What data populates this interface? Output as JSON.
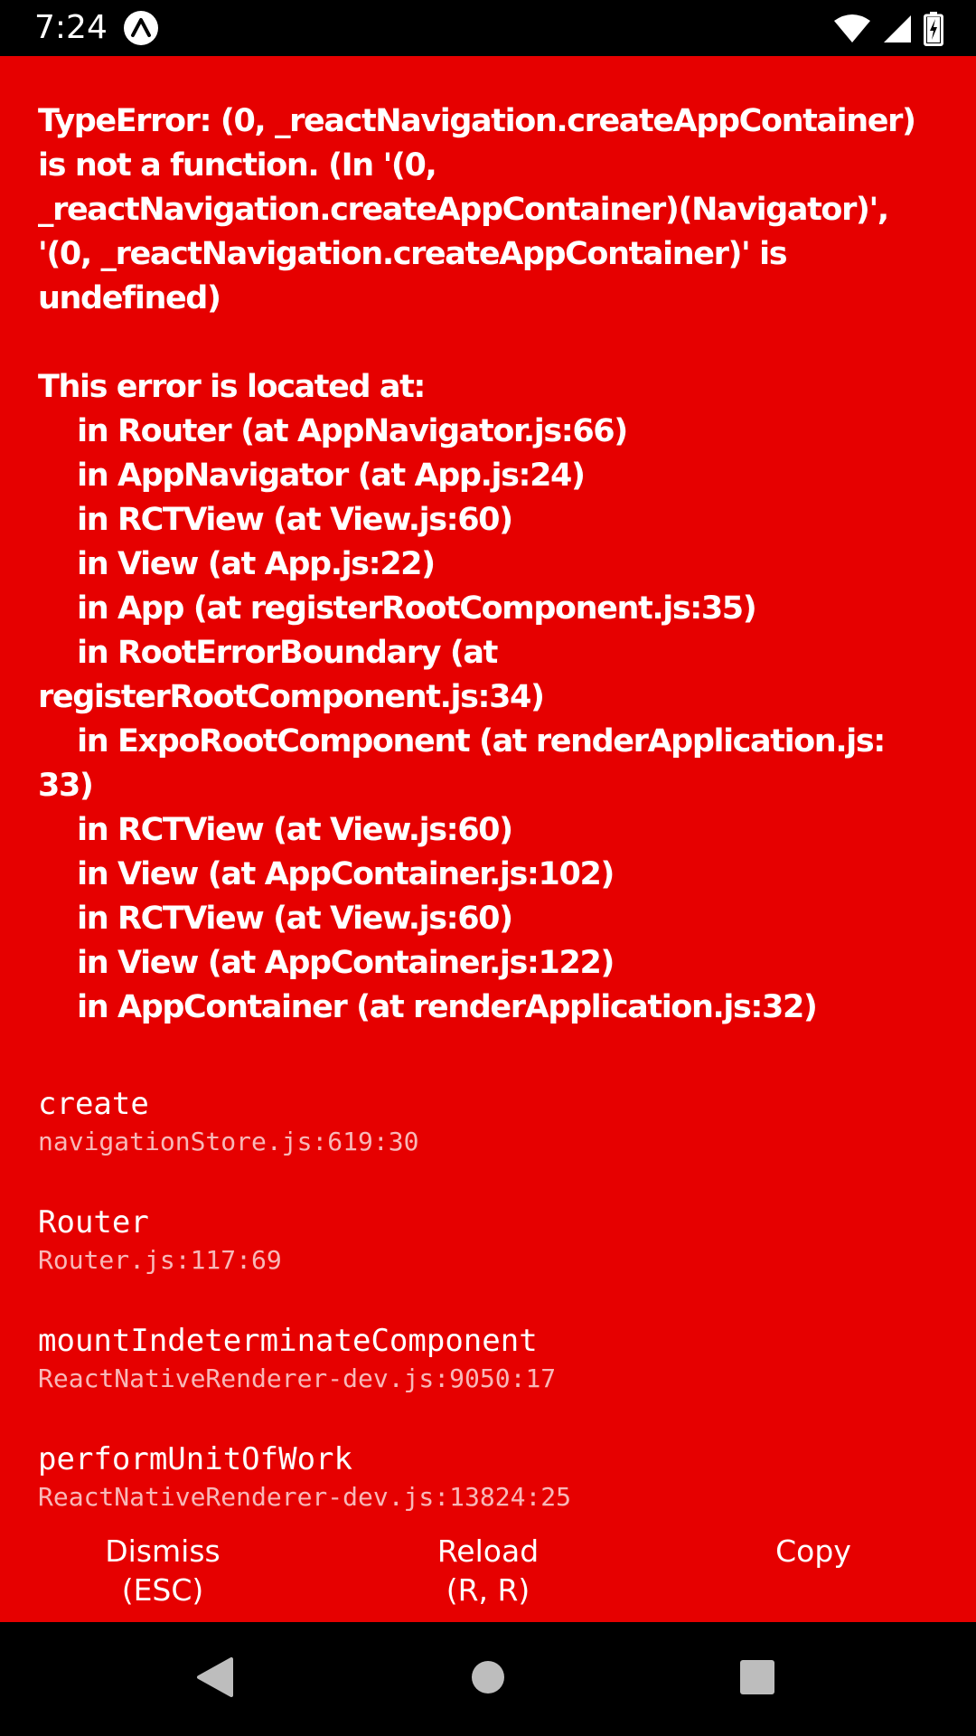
{
  "status_bar": {
    "time": "7:24",
    "app_icon": "expo-logo-icon",
    "icons": [
      "wifi-icon",
      "signal-icon",
      "battery-charging-icon"
    ]
  },
  "error": {
    "message": "TypeError: (0, _reactNavigation.createAppContainer)\nis not a function. (In '(0,\n_reactNavigation.createAppContainer)(Navigator)',\n'(0, _reactNavigation.createAppContainer)' is\nundefined)\n\nThis error is located at:\n    in Router (at AppNavigator.js:66)\n    in AppNavigator (at App.js:24)\n    in RCTView (at View.js:60)\n    in View (at App.js:22)\n    in App (at registerRootComponent.js:35)\n    in RootErrorBoundary (at\nregisterRootComponent.js:34)\n    in ExpoRootComponent (at renderApplication.js:\n33)\n    in RCTView (at View.js:60)\n    in View (at AppContainer.js:102)\n    in RCTView (at View.js:60)\n    in View (at AppContainer.js:122)\n    in AppContainer (at renderApplication.js:32)",
    "stack": [
      {
        "method": "create",
        "location": "navigationStore.js:619:30"
      },
      {
        "method": "Router",
        "location": "Router.js:117:69"
      },
      {
        "method": "mountIndeterminateComponent",
        "location": "ReactNativeRenderer-dev.js:9050:17"
      },
      {
        "method": "performUnitOfWork",
        "location": "ReactNativeRenderer-dev.js:13824:25"
      }
    ]
  },
  "buttons": {
    "dismiss": {
      "line1": "Dismiss",
      "line2": "(ESC)"
    },
    "reload": {
      "line1": "Reload",
      "line2": "(R, R)"
    },
    "copy": {
      "line1": "Copy"
    }
  },
  "navigation": {
    "icons": [
      "back-icon",
      "home-icon",
      "recents-icon"
    ]
  },
  "colors": {
    "error_background": "#e60000",
    "text": "#ffffff",
    "system_bar": "#000000"
  }
}
